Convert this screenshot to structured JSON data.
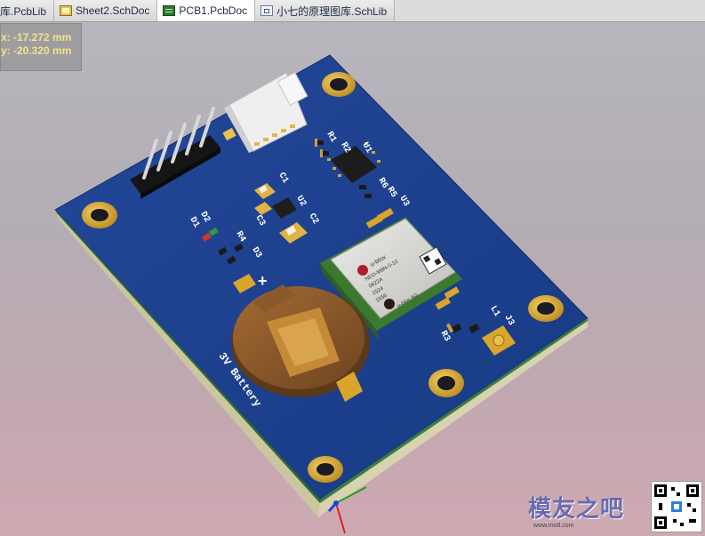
{
  "tabs": [
    {
      "label": "库.PcbLib",
      "icon": "pcblib-icon",
      "active": false
    },
    {
      "label": "Sheet2.SchDoc",
      "icon": "schdoc-icon",
      "active": false
    },
    {
      "label": "PCB1.PcbDoc",
      "icon": "pcbdoc-icon",
      "active": true
    },
    {
      "label": "小七的原理图库.SchLib",
      "icon": "schlib-icon",
      "active": false
    }
  ],
  "coords": {
    "x_text": "x: -17.272 mm",
    "y_text": "y: -20.320 mm"
  },
  "board": {
    "battery_label": "3V Battery",
    "designators": [
      "R1",
      "R2",
      "U1",
      "C1",
      "U2",
      "C3",
      "C2",
      "R6",
      "R5",
      "U3",
      "D2",
      "D1",
      "R4",
      "D3",
      "R3",
      "L1",
      "J3"
    ],
    "gps_module_text": [
      "u-blox",
      "NEO-M8N-0-10",
      "0622A",
      "1524",
      "1556",
      "u-blox AG"
    ],
    "plus_sign": "+"
  },
  "watermark": {
    "text": "模友之吧",
    "url": "www.mo8.com"
  },
  "colors": {
    "pcb_blue": "#1c3f8c",
    "pcb_edge": "#0f2a63",
    "pad_gold": "#d9a62b",
    "battery_brown": "#8b5a2b",
    "module_silver": "#d6d6d2"
  }
}
